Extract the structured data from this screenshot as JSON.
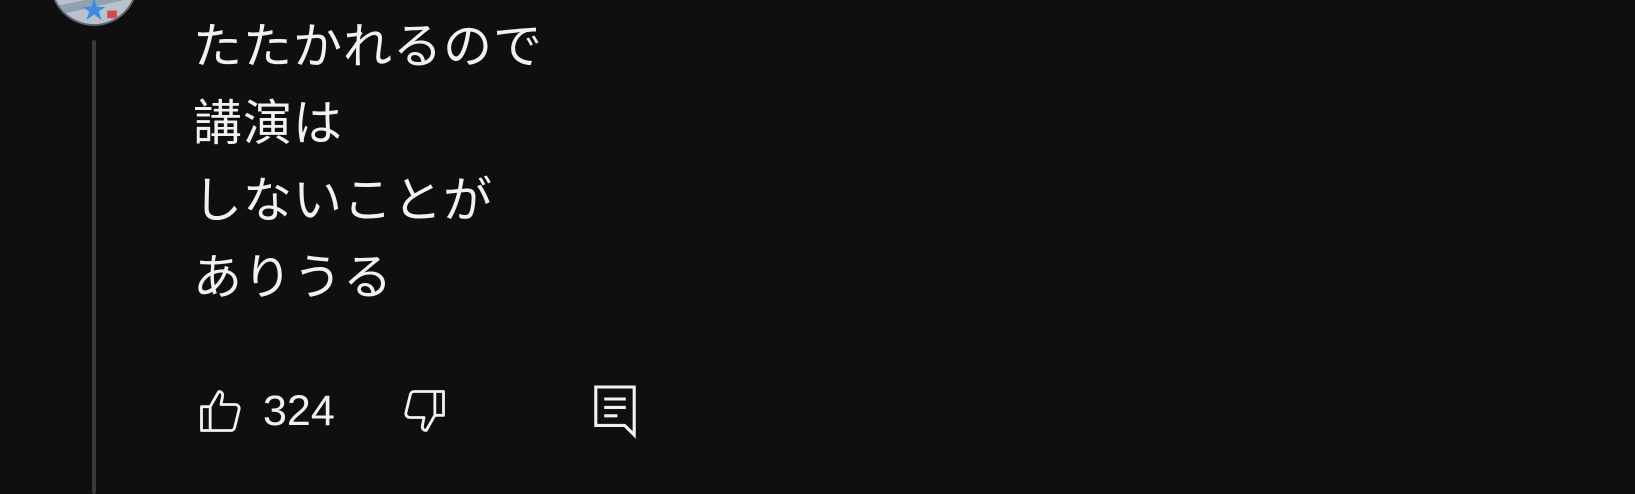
{
  "comment": {
    "lines": [
      "たたかれるので",
      "講演は",
      "しないことが",
      "ありうる"
    ]
  },
  "actions": {
    "like_count": "324",
    "like_icon": "thumbs-up-icon",
    "dislike_icon": "thumbs-down-icon",
    "reply_icon": "reply-comment-icon"
  },
  "avatar": {
    "icon": "avatar"
  },
  "colors": {
    "background": "#0f0f10",
    "text": "#f1f1f1",
    "thread_line": "#3a3a3a"
  }
}
